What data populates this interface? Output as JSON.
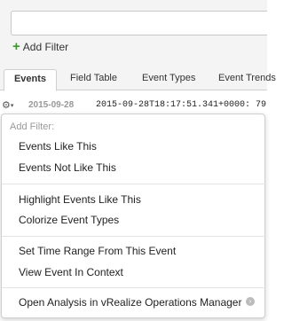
{
  "search": {
    "value": ""
  },
  "add_filter_label": "Add Filter",
  "tabs": [
    {
      "label": "Events"
    },
    {
      "label": "Field Table"
    },
    {
      "label": "Event Types"
    },
    {
      "label": "Event Trends"
    }
  ],
  "event_row": {
    "date": "2015-09-28",
    "timestamp": "2015-09-28T18:17:51.341+0000: 79"
  },
  "menu": {
    "header": "Add Filter:",
    "items": [
      "Events Like This",
      "Events Not Like This",
      "Highlight Events Like This",
      "Colorize Event Types",
      "Set Time Range From This Event",
      "View Event In Context",
      "Open Analysis in vRealize Operations Manager"
    ]
  },
  "icons": {
    "gear": "gear-icon",
    "plus": "plus-icon",
    "external": "arrow-right-circle-icon"
  },
  "colors": {
    "plus_green": "#3a9a2a",
    "header_gray": "#999999"
  }
}
